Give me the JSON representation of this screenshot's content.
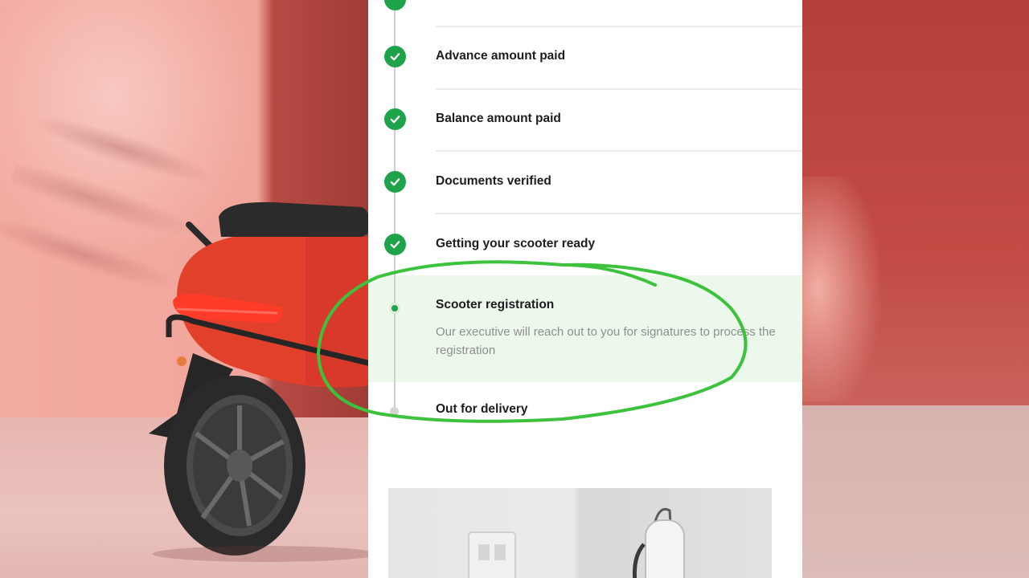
{
  "tracker": {
    "steps": [
      {
        "label": "Advance amount paid",
        "status": "completed"
      },
      {
        "label": "Balance amount paid",
        "status": "completed"
      },
      {
        "label": "Documents verified",
        "status": "completed"
      },
      {
        "label": "Getting your scooter ready",
        "status": "completed"
      },
      {
        "label": "Scooter registration",
        "status": "active",
        "description": "Our executive will reach out to you for signatures to process the registration"
      },
      {
        "label": "Out for delivery",
        "status": "pending"
      }
    ]
  },
  "icons": {
    "completed": "check-circle-icon",
    "active": "active-dot-icon",
    "pending": "pending-dot-icon"
  },
  "colors": {
    "accent_green": "#1fa34a",
    "active_row_bg": "#ecf8ec",
    "highlight_stroke": "#3cc23c",
    "background_red": "#c9635c"
  }
}
